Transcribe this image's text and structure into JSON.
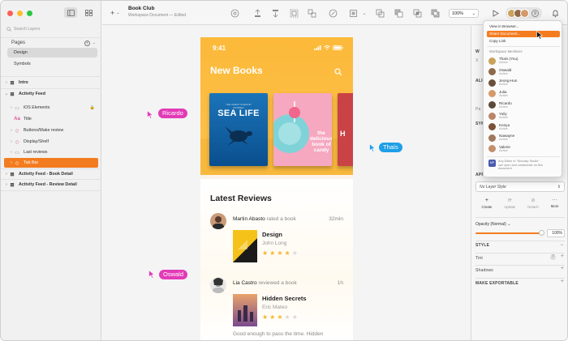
{
  "window": {
    "doc_title": "Book Club",
    "doc_subtitle": "Workspace Document — Edited"
  },
  "sidebar": {
    "search_placeholder": "Search Layers",
    "pages_label": "Pages",
    "pages": [
      {
        "label": "Design",
        "selected": true
      },
      {
        "label": "Symbols",
        "selected": false
      }
    ],
    "layers": [
      {
        "label": "Intro",
        "level": 0,
        "bold": true,
        "icon": "artboard"
      },
      {
        "label": "Activity Feed",
        "level": 0,
        "bold": true,
        "icon": "artboard",
        "expanded": true
      },
      {
        "label": "iOS Elements",
        "level": 1,
        "icon": "folder",
        "locked": true
      },
      {
        "label": "Title",
        "level": 1,
        "icon": "text"
      },
      {
        "label": "Buttons/Make review",
        "level": 1,
        "icon": "symbol"
      },
      {
        "label": "Display/Shelf",
        "level": 1,
        "icon": "symbol"
      },
      {
        "label": "Last reviews",
        "level": 1,
        "icon": "folder"
      },
      {
        "label": "Tab Bar",
        "level": 1,
        "icon": "symbol",
        "highlight": true
      },
      {
        "label": "Activity Feed - Book Detail",
        "level": 0,
        "bold": true,
        "icon": "artboard"
      },
      {
        "label": "Activity Feed - Review Detail",
        "level": 0,
        "bold": true,
        "icon": "artboard"
      }
    ]
  },
  "toolbar": {
    "zoom": "100%",
    "collaborator_count": "9"
  },
  "app": {
    "time": "9:41",
    "hero_title": "New Books",
    "books": [
      {
        "title": "SEA LIFE",
        "subtitle": "THE GREAT OCEANIC JOURNEY"
      },
      {
        "title": "the delicious book of candy"
      },
      {
        "title": "H"
      }
    ],
    "reviews_title": "Latest Reviews",
    "reviews": [
      {
        "user": "Martin Abasto",
        "action": "rated a book",
        "time": "32min",
        "book": "Design",
        "author": "John Long",
        "rating": 4
      },
      {
        "user": "Lia Castro",
        "action": "reviewed a book",
        "time": "1h",
        "book": "Hidden Secrets",
        "author": "Eric Mateo",
        "rating": 3,
        "snippet": "Good enough to pass the time. Hidden"
      }
    ]
  },
  "cursors": [
    {
      "name": "Ricardo",
      "color": "#e23bb7"
    },
    {
      "name": "Thaís",
      "color": "#1e9fe8"
    },
    {
      "name": "Oswald",
      "color": "#e23bb7"
    }
  ],
  "share_menu": {
    "view_in_browser": "View in Browser...",
    "share_document": "Share Document...",
    "copy_link": "Copy Link",
    "members_header": "Workspace Members",
    "members": [
      {
        "name": "Thaís (You)",
        "status": "Active",
        "color": "#c9a15b"
      },
      {
        "name": "Oswald",
        "status": "Active",
        "color": "#8f6a4a"
      },
      {
        "name": "Jeong-Hun",
        "status": "Active",
        "color": "#6b4f3a"
      },
      {
        "name": "Julia",
        "status": "Active",
        "color": "#d49a6a"
      },
      {
        "name": "Ricardo",
        "status": "Active",
        "color": "#5a4a3a"
      },
      {
        "name": "Yuliy",
        "status": "Active",
        "color": "#b9856a"
      },
      {
        "name": "Kenya",
        "status": "Active",
        "color": "#7b5237"
      },
      {
        "name": "Nawayne",
        "status": "Active",
        "color": "#a0785a"
      },
      {
        "name": "Valerie",
        "status": "Active",
        "color": "#c3906d"
      }
    ],
    "footer_badge": "MP",
    "footer_text_1": "Any Editor in \"Monday Studio\"",
    "footer_text_2": "can open and collaborate on this",
    "footer_text_3": "document"
  },
  "inspector": {
    "layer_style": "No Layer Style",
    "actions": [
      "Create",
      "Update",
      "Detach",
      "More"
    ],
    "opacity_label": "Opacity (Normal)",
    "opacity_value": "100%",
    "opacity": 1.0,
    "sections": {
      "appearance": "APPEARANCE",
      "style": "STYLE",
      "tint": "Tint",
      "shadows": "Shadows",
      "exportable": "MAKE EXPORTABLE"
    },
    "partial_labels": {
      "align": "ALIGN",
      "symbol": "SYMB",
      "size_w": "W",
      "size_h": "H",
      "size_x": "X",
      "pos": "Pa"
    }
  },
  "colors": {
    "accent": "#f47c20",
    "hero_yellow": "#fcb93a"
  }
}
